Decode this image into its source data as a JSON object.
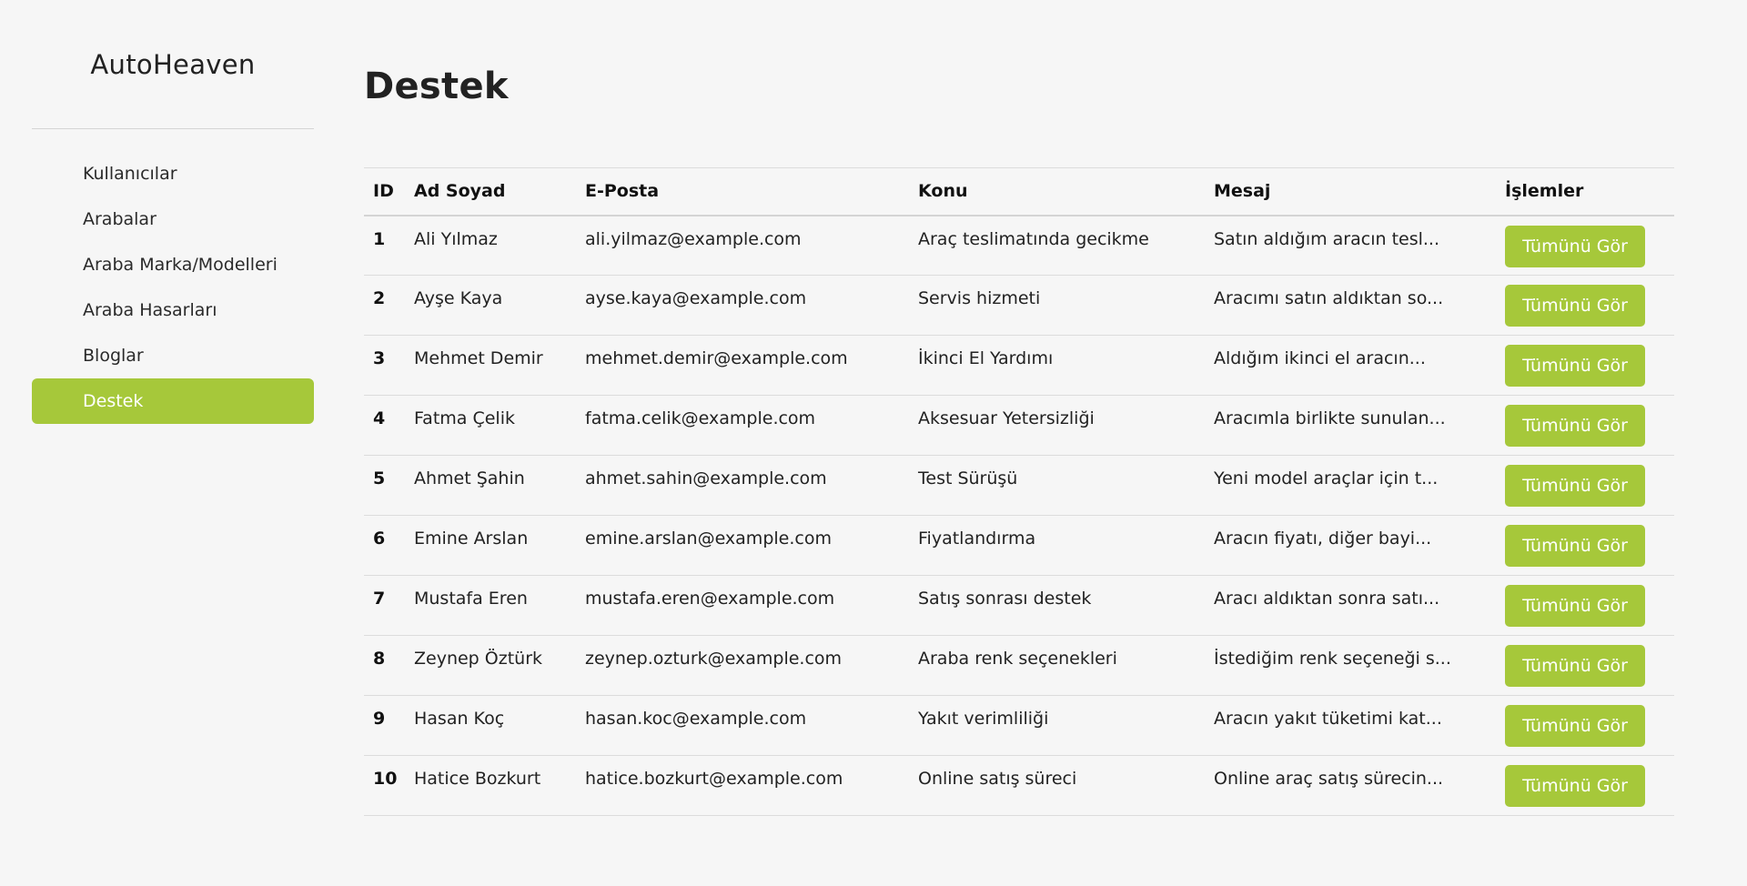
{
  "sidebar": {
    "brand": "AutoHeaven",
    "items": [
      {
        "label": "Kullanıcılar",
        "name": "sidebar-item-kullanicilar",
        "active": false
      },
      {
        "label": "Arabalar",
        "name": "sidebar-item-arabalar",
        "active": false
      },
      {
        "label": "Araba Marka/Modelleri",
        "name": "sidebar-item-araba-marka-modelleri",
        "active": false
      },
      {
        "label": "Araba Hasarları",
        "name": "sidebar-item-araba-hasarlari",
        "active": false
      },
      {
        "label": "Bloglar",
        "name": "sidebar-item-bloglar",
        "active": false
      },
      {
        "label": "Destek",
        "name": "sidebar-item-destek",
        "active": true
      }
    ],
    "accent_color": "#a6c83a"
  },
  "main": {
    "title": "Destek",
    "table": {
      "headers": [
        "ID",
        "Ad Soyad",
        "E-Posta",
        "Konu",
        "Mesaj",
        "İşlemler"
      ],
      "action_label": "Tümünü Gör",
      "rows": [
        {
          "id": "1",
          "name": "Ali Yılmaz",
          "email": "ali.yilmaz@example.com",
          "subject": "Araç teslimatında gecikme",
          "message": "Satın aldığım aracın tesl..."
        },
        {
          "id": "2",
          "name": "Ayşe Kaya",
          "email": "ayse.kaya@example.com",
          "subject": "Servis hizmeti",
          "message": "Aracımı satın aldıktan so..."
        },
        {
          "id": "3",
          "name": "Mehmet Demir",
          "email": "mehmet.demir@example.com",
          "subject": "İkinci El Yardımı",
          "message": "Aldığım ikinci el aracın..."
        },
        {
          "id": "4",
          "name": "Fatma Çelik",
          "email": "fatma.celik@example.com",
          "subject": "Aksesuar Yetersizliği",
          "message": "Aracımla birlikte sunulan..."
        },
        {
          "id": "5",
          "name": "Ahmet Şahin",
          "email": "ahmet.sahin@example.com",
          "subject": "Test Sürüşü",
          "message": "Yeni model araçlar için t..."
        },
        {
          "id": "6",
          "name": "Emine Arslan",
          "email": "emine.arslan@example.com",
          "subject": "Fiyatlandırma",
          "message": "Aracın fiyatı, diğer bayi..."
        },
        {
          "id": "7",
          "name": "Mustafa Eren",
          "email": "mustafa.eren@example.com",
          "subject": "Satış sonrası destek",
          "message": "Aracı aldıktan sonra satı..."
        },
        {
          "id": "8",
          "name": "Zeynep Öztürk",
          "email": "zeynep.ozturk@example.com",
          "subject": "Araba renk seçenekleri",
          "message": "İstediğim renk seçeneği s..."
        },
        {
          "id": "9",
          "name": "Hasan Koç",
          "email": "hasan.koc@example.com",
          "subject": "Yakıt verimliliği",
          "message": "Aracın yakıt tüketimi kat..."
        },
        {
          "id": "10",
          "name": "Hatice Bozkurt",
          "email": "hatice.bozkurt@example.com",
          "subject": "Online satış süreci",
          "message": "Online araç satış sürecin..."
        }
      ]
    }
  }
}
